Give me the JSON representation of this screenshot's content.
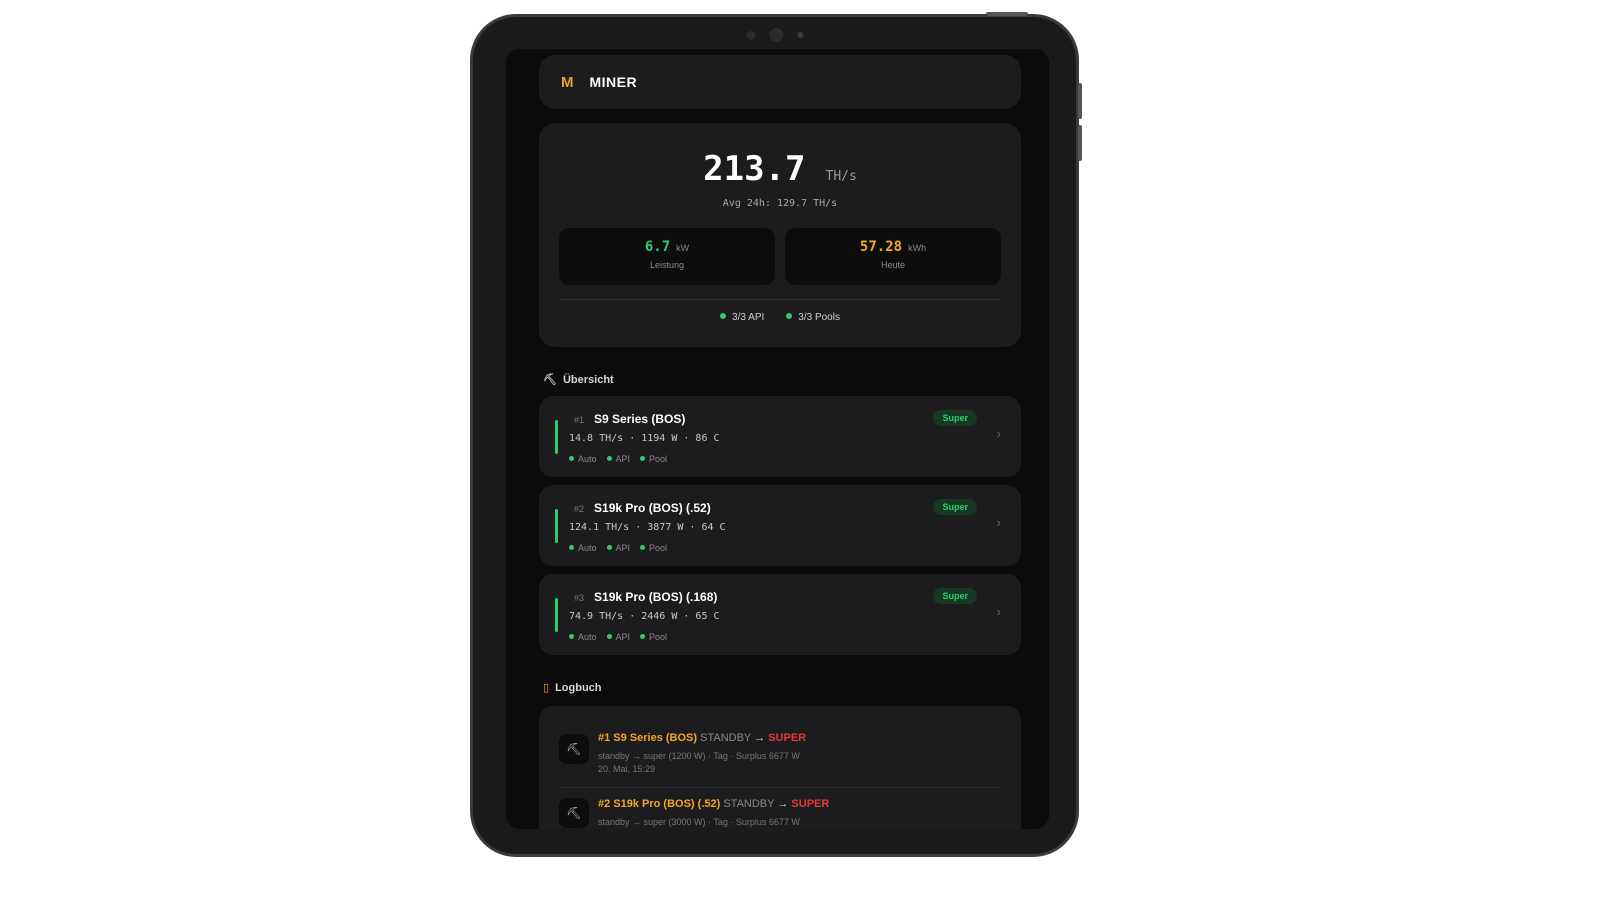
{
  "header": {
    "logo": "M",
    "title": "MINER"
  },
  "hero": {
    "hashrate": "213.7",
    "hashrate_unit": "TH/s",
    "avg_24h": "Avg 24h: 129.7 TH/s",
    "power": {
      "value": "6.7",
      "unit": "kW",
      "label": "Leistung"
    },
    "energy": {
      "value": "57.28",
      "unit": "kWh",
      "label": "Heute"
    },
    "status": {
      "api": "3/3 API",
      "pools": "3/3 Pools"
    }
  },
  "overview": {
    "title": "Übersicht",
    "miners": [
      {
        "num": "#1",
        "name": "S9 Series (BOS)",
        "stats": "14.8 TH/s · 1194 W · 86 C",
        "badge": "Super",
        "tags": [
          "Auto",
          "API",
          "Pool"
        ]
      },
      {
        "num": "#2",
        "name": "S19k Pro (BOS) (.52)",
        "stats": "124.1 TH/s · 3877 W · 64 C",
        "badge": "Super",
        "tags": [
          "Auto",
          "API",
          "Pool"
        ]
      },
      {
        "num": "#3",
        "name": "S19k Pro (BOS) (.168)",
        "stats": "74.9 TH/s · 2446 W · 65 C",
        "badge": "Super",
        "tags": [
          "Auto",
          "API",
          "Pool"
        ]
      }
    ]
  },
  "logbook": {
    "title": "Logbuch",
    "entries": [
      {
        "name": "#1 S9 Series (BOS)",
        "from": "STANDBY",
        "arrow": "→",
        "to": "SUPER",
        "detail": "standby → super (1200 W) · Tag · Surplus 6677 W",
        "time": "20. Mai, 15:29"
      },
      {
        "name": "#2 S19k Pro (BOS) (.52)",
        "from": "STANDBY",
        "arrow": "→",
        "to": "SUPER",
        "detail": "standby → super (3000 W) · Tag · Surplus 6677 W",
        "time": ""
      }
    ]
  },
  "colors": {
    "accent_green": "#2ecc71",
    "accent_orange": "#f5a623",
    "accent_red": "#e53935",
    "card_bg": "#1c1c1e"
  }
}
